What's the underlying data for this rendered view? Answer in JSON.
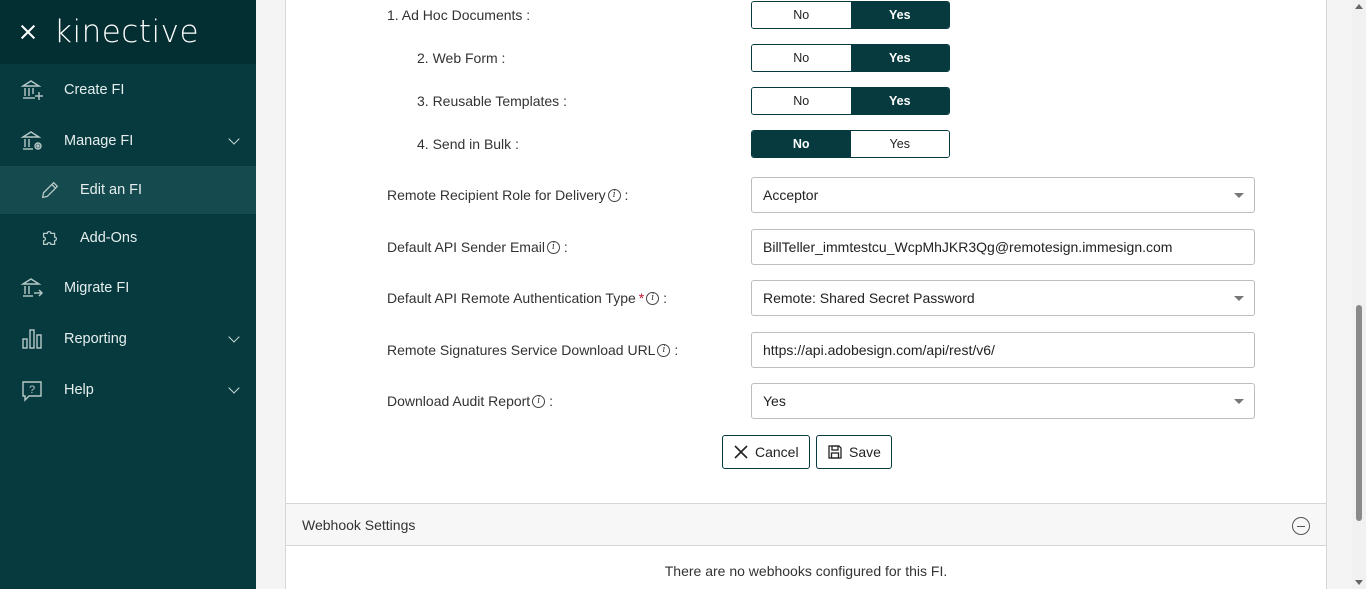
{
  "sidebar": {
    "logo": "kinective",
    "items": [
      {
        "label": "Create FI"
      },
      {
        "label": "Manage FI"
      },
      {
        "label": "Edit an FI"
      },
      {
        "label": "Add-Ons"
      },
      {
        "label": "Migrate FI"
      },
      {
        "label": "Reporting"
      },
      {
        "label": "Help"
      }
    ]
  },
  "features": [
    {
      "label": "1. Ad Hoc Documents :",
      "selected": "Yes"
    },
    {
      "label": "2. Web Form :",
      "selected": "Yes"
    },
    {
      "label": "3. Reusable Templates :",
      "selected": "Yes"
    },
    {
      "label": "4. Send in Bulk :",
      "selected": "No"
    }
  ],
  "toggle": {
    "no": "No",
    "yes": "Yes"
  },
  "fields": {
    "recipient_role": {
      "label": "Remote Recipient Role for Delivery",
      "value": "Acceptor"
    },
    "sender_email": {
      "label": "Default API Sender Email",
      "value": "BillTeller_immtestcu_WcpMhJKR3Qg@remotesign.immesign.com"
    },
    "auth_type": {
      "label": "Default API Remote Authentication Type",
      "value": "Remote: Shared Secret Password"
    },
    "download_url": {
      "label": "Remote Signatures Service Download URL",
      "value": "https://api.adobesign.com/api/rest/v6/"
    },
    "audit_report": {
      "label": "Download Audit Report",
      "value": "Yes"
    }
  },
  "colon": ":",
  "required_mark": "*",
  "info_glyph": "i",
  "buttons": {
    "cancel": "Cancel",
    "save": "Save"
  },
  "webhook": {
    "title": "Webhook Settings",
    "empty": "There are no webhooks configured for this FI."
  },
  "colors": {
    "primary": "#063a3e",
    "required": "#c8102e"
  }
}
